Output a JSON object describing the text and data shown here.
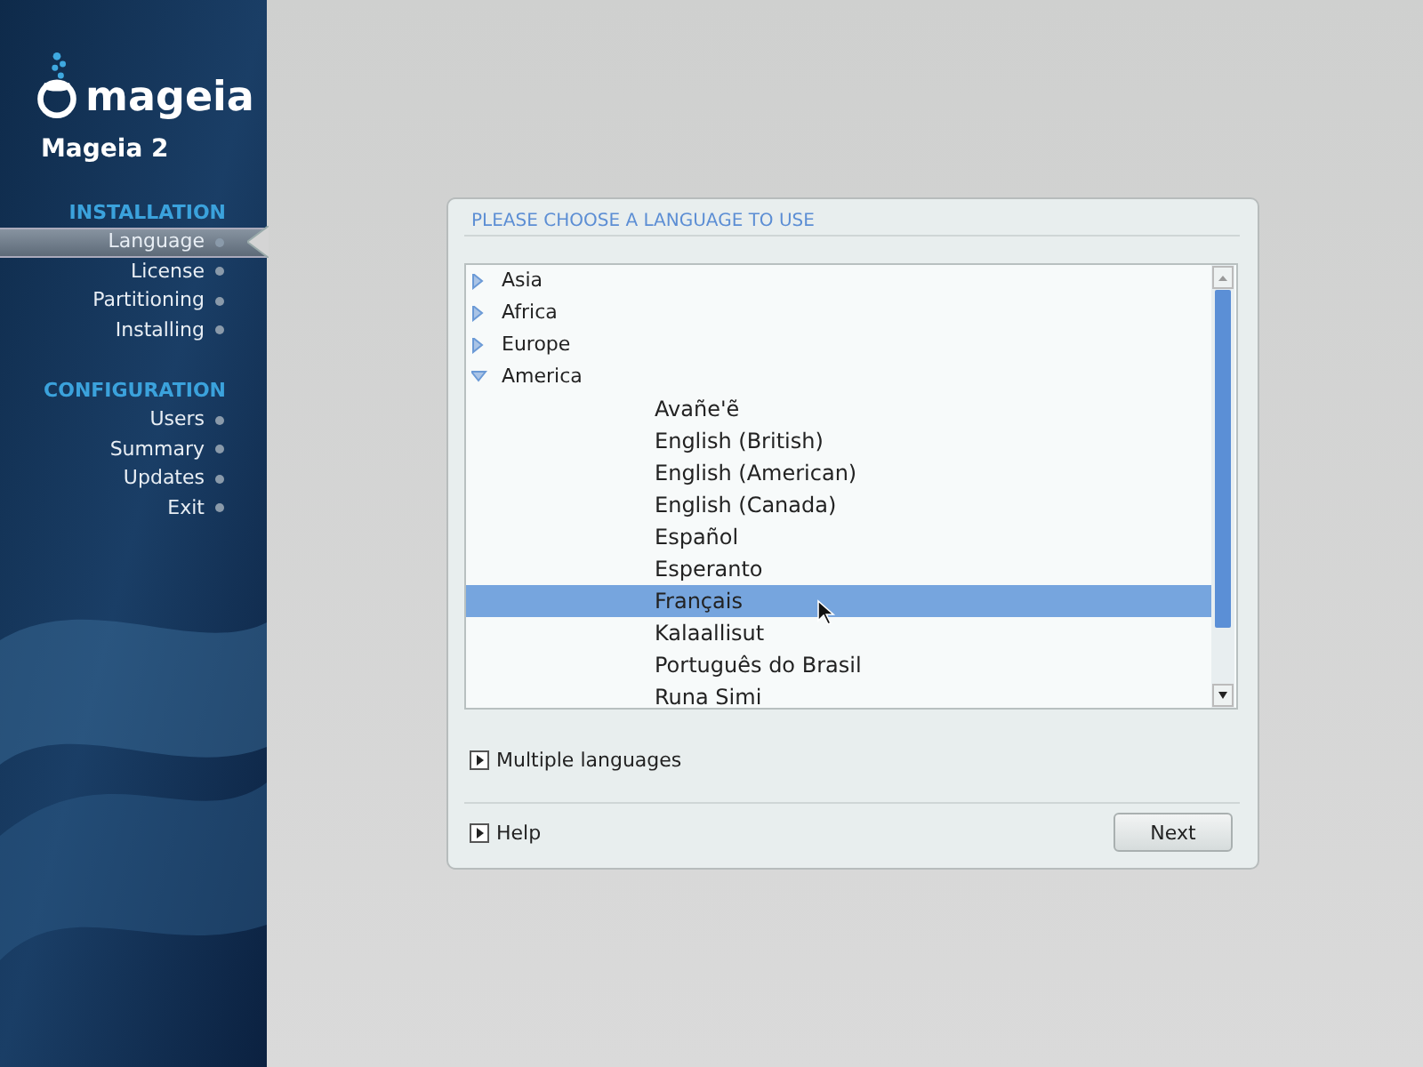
{
  "sidebar": {
    "logo_text": "mageia",
    "product": "Mageia 2",
    "sections": [
      {
        "title": "INSTALLATION",
        "items": [
          {
            "label": "Language",
            "selected": true
          },
          {
            "label": "License",
            "selected": false
          },
          {
            "label": "Partitioning",
            "selected": false
          },
          {
            "label": "Installing",
            "selected": false
          }
        ]
      },
      {
        "title": "CONFIGURATION",
        "items": [
          {
            "label": "Users",
            "selected": false
          },
          {
            "label": "Summary",
            "selected": false
          },
          {
            "label": "Updates",
            "selected": false
          },
          {
            "label": "Exit",
            "selected": false
          }
        ]
      }
    ]
  },
  "dialog": {
    "title": "PLEASE CHOOSE A LANGUAGE TO USE",
    "tree": [
      {
        "label": "Asia",
        "expanded": false
      },
      {
        "label": "Africa",
        "expanded": false
      },
      {
        "label": "Europe",
        "expanded": false
      },
      {
        "label": "America",
        "expanded": true,
        "children": [
          {
            "label": "Avañe'ẽ",
            "selected": false
          },
          {
            "label": "English (British)",
            "selected": false
          },
          {
            "label": "English (American)",
            "selected": false
          },
          {
            "label": "English (Canada)",
            "selected": false
          },
          {
            "label": "Español",
            "selected": false
          },
          {
            "label": "Esperanto",
            "selected": false
          },
          {
            "label": "Français",
            "selected": true
          },
          {
            "label": "Kalaallisut",
            "selected": false
          },
          {
            "label": "Português do Brasil",
            "selected": false
          },
          {
            "label": "Runa Simi",
            "selected": false
          }
        ]
      }
    ],
    "expander": {
      "label": "Multiple languages",
      "expanded": false
    },
    "help": {
      "label": "Help",
      "expanded": false
    },
    "buttons": [
      "Next"
    ]
  }
}
